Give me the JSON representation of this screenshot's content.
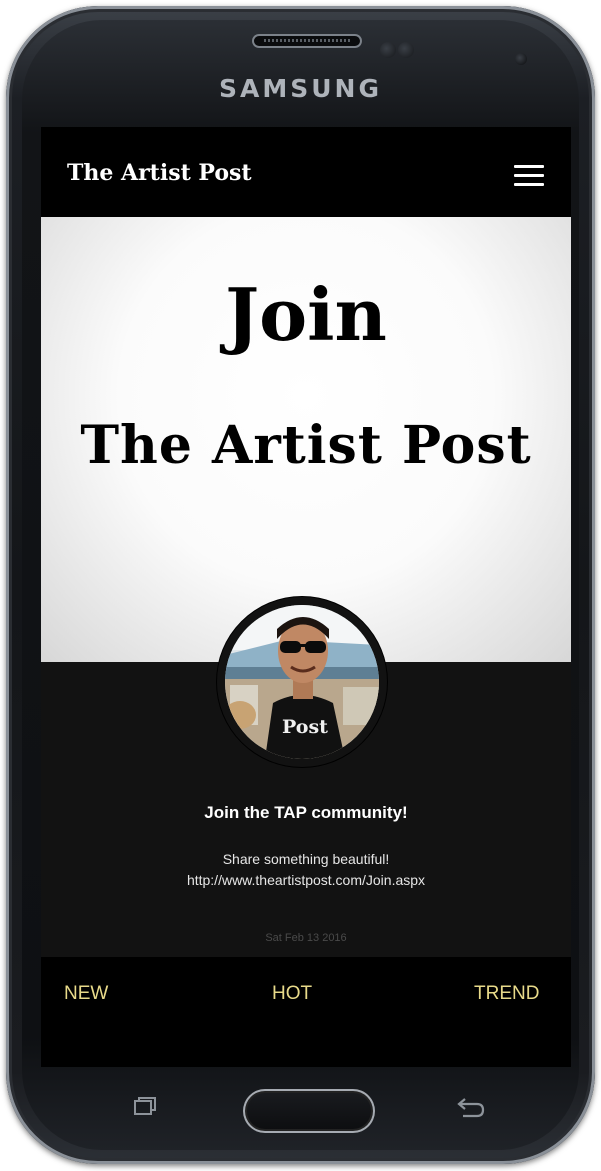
{
  "device": {
    "brand": "SAMSUNG"
  },
  "header": {
    "logo": "The Artist Post",
    "menu_icon": "hamburger-menu-icon"
  },
  "hero": {
    "line1": "Join",
    "line2": "The Artist Post"
  },
  "post": {
    "avatar_shirt_text": "Post",
    "title": "Join the TAP community!",
    "text_line1": "Share something beautiful!",
    "text_line2": "http://www.theartistpost.com/Join.aspx",
    "date": "Sat Feb 13 2016"
  },
  "tabs": [
    {
      "label": "NEW"
    },
    {
      "label": "HOT"
    },
    {
      "label": "TREND"
    }
  ],
  "colors": {
    "tab_text": "#e8da8a",
    "card_bg": "#121212",
    "topbar_bg": "#000000"
  },
  "hardware_icons": [
    "recent-apps-icon",
    "home-button",
    "back-icon"
  ]
}
